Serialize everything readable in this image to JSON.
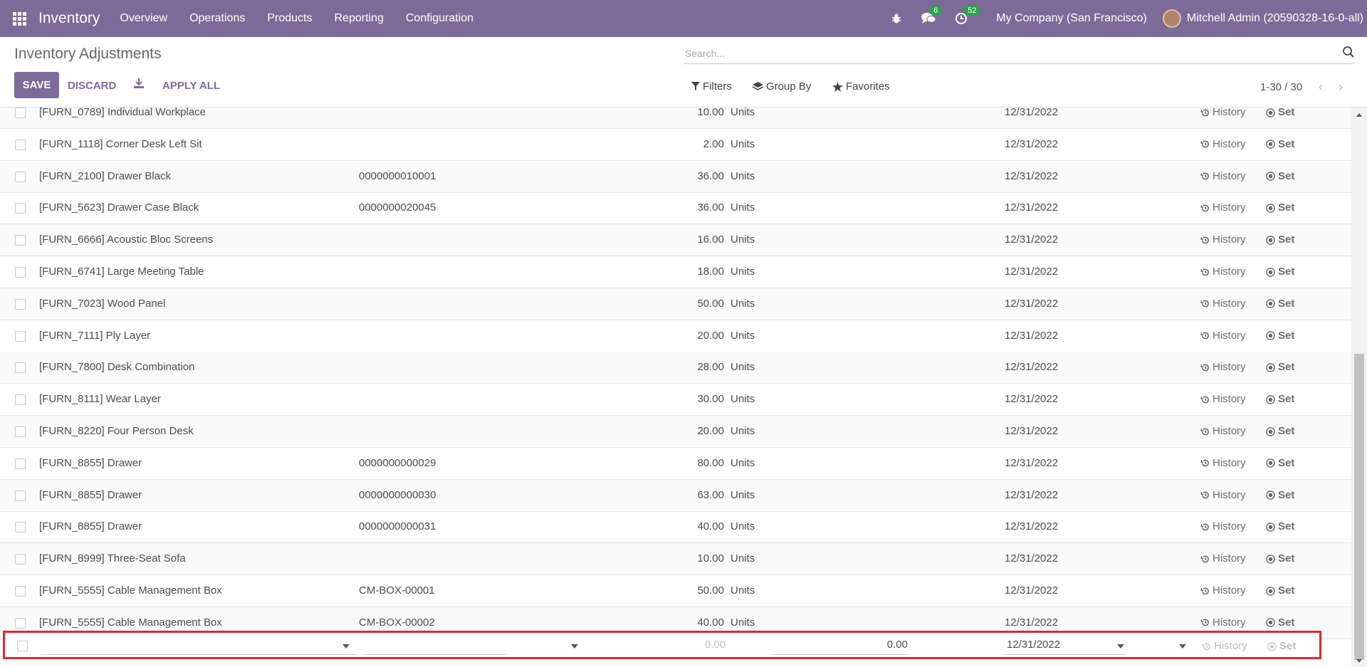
{
  "navbar": {
    "app_name": "Inventory",
    "menu": [
      "Overview",
      "Operations",
      "Products",
      "Reporting",
      "Configuration"
    ],
    "messages_count": "6",
    "activities_count": "52",
    "company": "My Company (San Francisco)",
    "user": "Mitchell Admin (20590328-16-0-all)"
  },
  "control": {
    "title": "Inventory Adjustments",
    "search_placeholder": "Search...",
    "save_label": "SAVE",
    "discard_label": "DISCARD",
    "apply_all_label": "APPLY ALL",
    "filters_label": "Filters",
    "group_by_label": "Group By",
    "favorites_label": "Favorites",
    "pager": "1-30 / 30"
  },
  "rows": [
    {
      "product": "[FURN_0789] Individual Workplace",
      "lot": "",
      "qty": "10.00",
      "uom": "Units",
      "date": "12/31/2022"
    },
    {
      "product": "[FURN_1118] Corner Desk Left Sit",
      "lot": "",
      "qty": "2.00",
      "uom": "Units",
      "date": "12/31/2022"
    },
    {
      "product": "[FURN_2100] Drawer Black",
      "lot": "0000000010001",
      "qty": "36.00",
      "uom": "Units",
      "date": "12/31/2022"
    },
    {
      "product": "[FURN_5623] Drawer Case Black",
      "lot": "0000000020045",
      "qty": "36.00",
      "uom": "Units",
      "date": "12/31/2022"
    },
    {
      "product": "[FURN_6666] Acoustic Bloc Screens",
      "lot": "",
      "qty": "16.00",
      "uom": "Units",
      "date": "12/31/2022"
    },
    {
      "product": "[FURN_6741] Large Meeting Table",
      "lot": "",
      "qty": "18.00",
      "uom": "Units",
      "date": "12/31/2022"
    },
    {
      "product": "[FURN_7023] Wood Panel",
      "lot": "",
      "qty": "50.00",
      "uom": "Units",
      "date": "12/31/2022"
    },
    {
      "product": "[FURN_7111] Ply Layer",
      "lot": "",
      "qty": "20.00",
      "uom": "Units",
      "date": "12/31/2022"
    },
    {
      "product": "[FURN_7800] Desk Combination",
      "lot": "",
      "qty": "28.00",
      "uom": "Units",
      "date": "12/31/2022"
    },
    {
      "product": "[FURN_8111] Wear Layer",
      "lot": "",
      "qty": "30.00",
      "uom": "Units",
      "date": "12/31/2022"
    },
    {
      "product": "[FURN_8220] Four Person Desk",
      "lot": "",
      "qty": "20.00",
      "uom": "Units",
      "date": "12/31/2022"
    },
    {
      "product": "[FURN_8855] Drawer",
      "lot": "0000000000029",
      "qty": "80.00",
      "uom": "Units",
      "date": "12/31/2022"
    },
    {
      "product": "[FURN_8855] Drawer",
      "lot": "0000000000030",
      "qty": "63.00",
      "uom": "Units",
      "date": "12/31/2022"
    },
    {
      "product": "[FURN_8855] Drawer",
      "lot": "0000000000031",
      "qty": "40.00",
      "uom": "Units",
      "date": "12/31/2022"
    },
    {
      "product": "[FURN_8999] Three-Seat Sofa",
      "lot": "",
      "qty": "10.00",
      "uom": "Units",
      "date": "12/31/2022"
    },
    {
      "product": "[FURN_5555] Cable Management Box",
      "lot": "CM-BOX-00001",
      "qty": "50.00",
      "uom": "Units",
      "date": "12/31/2022"
    },
    {
      "product": "[FURN_5555] Cable Management Box",
      "lot": "CM-BOX-00002",
      "qty": "40.00",
      "uom": "Units",
      "date": "12/31/2022"
    }
  ],
  "row_actions": {
    "history_label": "History",
    "set_label": "Set"
  },
  "new_row": {
    "on_hand": "0.00",
    "counted": "0.00",
    "date": "12/31/2022",
    "history_label": "History",
    "set_label": "Set"
  }
}
